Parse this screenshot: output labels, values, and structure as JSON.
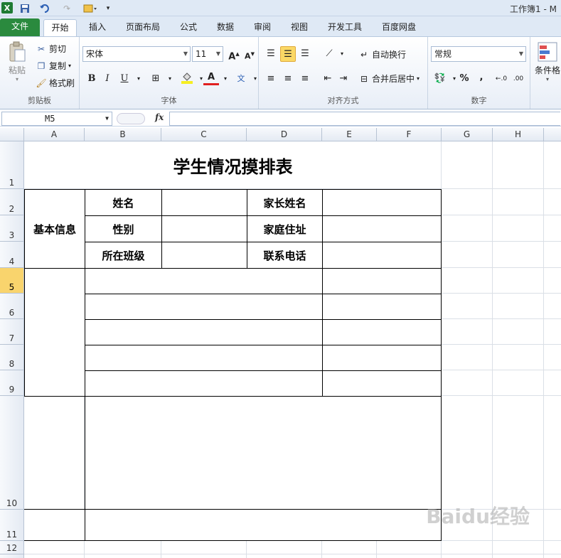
{
  "window": {
    "title": "工作簿1 - M"
  },
  "quick_access": {
    "app_icon": "X",
    "save_icon": "save-icon",
    "undo_icon": "undo-icon",
    "redo_icon": "redo-icon"
  },
  "tabs": [
    "文件",
    "开始",
    "插入",
    "页面布局",
    "公式",
    "数据",
    "审阅",
    "视图",
    "开发工具",
    "百度网盘"
  ],
  "ribbon": {
    "clipboard": {
      "paste": "粘贴",
      "cut": "剪切",
      "copy": "复制",
      "format_painter": "格式刷",
      "label": "剪贴板"
    },
    "font": {
      "family": "宋体",
      "size": "11",
      "bold": "B",
      "italic": "I",
      "underline": "U",
      "label": "字体"
    },
    "alignment": {
      "wrap": "自动换行",
      "merge": "合并后居中",
      "label": "对齐方式"
    },
    "number": {
      "format": "常规",
      "percent": "%",
      "comma": ",",
      "label": "数字"
    },
    "styles": {
      "conditional": "条件格"
    }
  },
  "formula_bar": {
    "name_box": "M5",
    "fx": "fx",
    "value": ""
  },
  "columns": [
    "A",
    "B",
    "C",
    "D",
    "E",
    "F",
    "G",
    "H"
  ],
  "rows": [
    "1",
    "2",
    "3",
    "4",
    "5",
    "6",
    "7",
    "8",
    "9",
    "10",
    "11",
    "12"
  ],
  "selected_row": "5",
  "sheet": {
    "title": "学生情况摸排表",
    "basic_info": "基本信息",
    "name": "姓名",
    "gender": "性别",
    "class": "所在班级",
    "parent_name": "家长姓名",
    "address": "家庭住址",
    "phone": "联系电话"
  },
  "watermark": "Baidu经验"
}
